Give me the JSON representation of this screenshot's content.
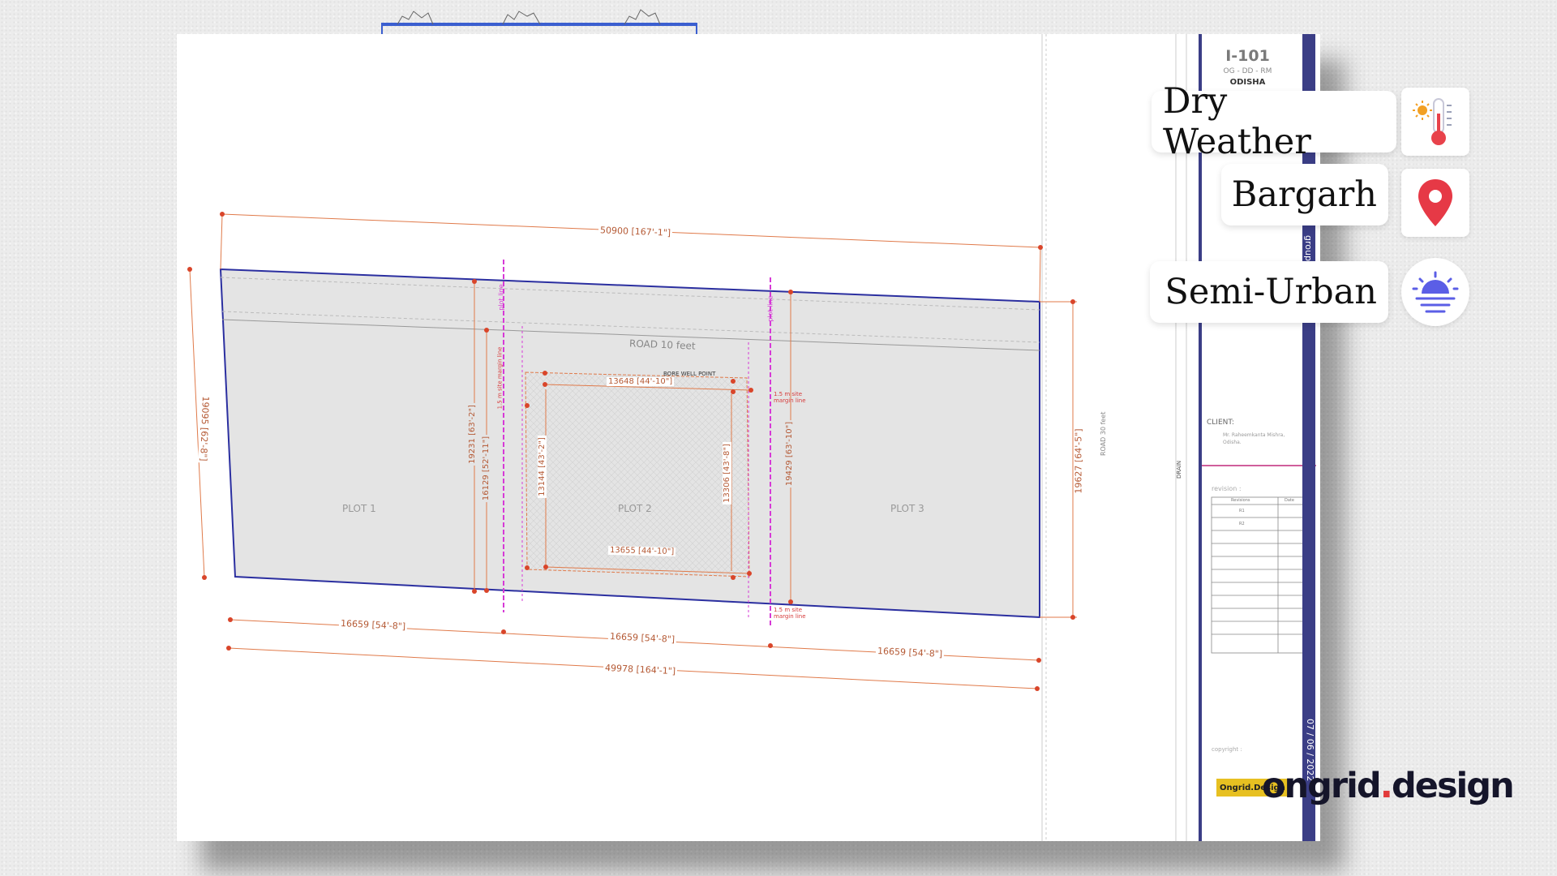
{
  "sheet": {
    "code": "I-101",
    "sub_code": "OG - DD - RM",
    "state": "ODISHA",
    "client_label": "CLIENT:",
    "client_name": "Mr. Raheemkanta Mishra, Odisha.",
    "revision_label": "revision :",
    "revision_headers": [
      "Revisions",
      "Date"
    ],
    "revision_rows": [
      "R1",
      "R2"
    ],
    "copyright_label": "copyright :",
    "date": "07 / 06 / 2022",
    "group_tag": "group",
    "drain_label": "DRAIN",
    "logo_text": "Ongrid.Design"
  },
  "drawing": {
    "top_dimension": "50900 [167'-1\"]",
    "bottom_total_dimension": "49978 [164'-1\"]",
    "plot_widths": [
      "16659 [54'-8\"]",
      "16659 [54'-8\"]",
      "16659 [54'-8\"]"
    ],
    "left_height": "19095 [62'-8\"]",
    "right_height": "19627 [64'-5\"]",
    "plot_labels": [
      "PLOT 1",
      "PLOT 2",
      "PLOT 3"
    ],
    "road_label": "ROAD 10 feet",
    "road_right_label": "ROAD 30 feet",
    "bore_well_label": "BORE WELL POINT",
    "plot_line_label": "plot line",
    "margin_line_label": "1.5 m site margin line",
    "inner_top": "13648 [44'-10\"]",
    "inner_bottom": "13655 [44'-10\"]",
    "inner_left": "13144 [43'-2\"]",
    "inner_right": "13306 [43'-8\"]",
    "plot2_left_outer": "19231 [63'-2\"]",
    "plot2_left_inner": "16129 [52'-11\"]",
    "plot2_right": "19429 [63'-10\"]"
  },
  "info_cards": [
    {
      "label": "Dry Weather",
      "icon": "thermometer-icon"
    },
    {
      "label": "Bargarh",
      "icon": "location-pin-icon"
    },
    {
      "label": "Semi-Urban",
      "icon": "sunrise-icon"
    }
  ],
  "brand": {
    "name_a": "ongrid",
    "dot": ".",
    "name_b": "design"
  },
  "colors": {
    "plot_fill": "#e4e4e4",
    "boundary": "#2b2fa0",
    "dimension": "#e07a4a",
    "plot_line": "#d63ad6",
    "title_bar": "#3b3e86"
  }
}
